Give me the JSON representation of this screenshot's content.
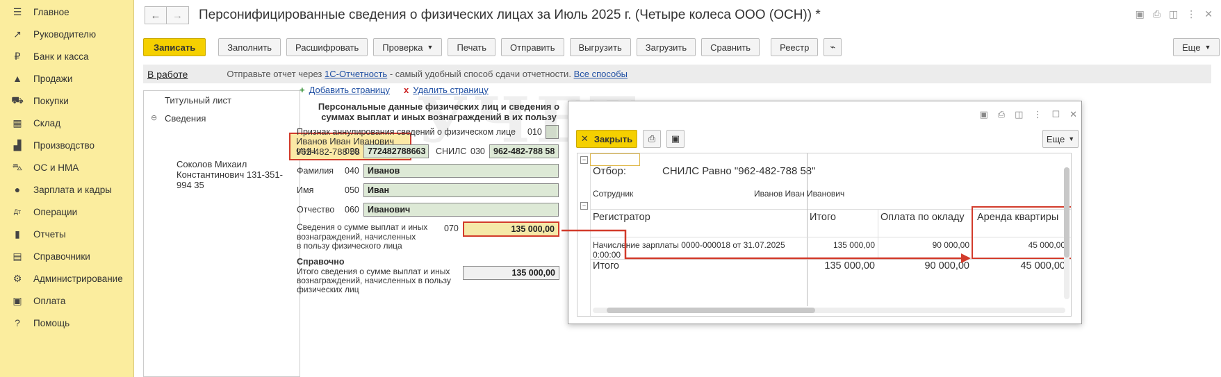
{
  "sidebar": {
    "items": [
      {
        "label": "Главное",
        "icon": "menu-icon"
      },
      {
        "label": "Руководителю",
        "icon": "trend-icon"
      },
      {
        "label": "Банк и касса",
        "icon": "ruble-icon"
      },
      {
        "label": "Продажи",
        "icon": "bag-icon"
      },
      {
        "label": "Покупки",
        "icon": "cart-icon"
      },
      {
        "label": "Склад",
        "icon": "grid-icon"
      },
      {
        "label": "Производство",
        "icon": "factory-icon"
      },
      {
        "label": "ОС и НМА",
        "icon": "truck-icon"
      },
      {
        "label": "Зарплата и кадры",
        "icon": "person-icon"
      },
      {
        "label": "Операции",
        "icon": "dt-kt-icon"
      },
      {
        "label": "Отчеты",
        "icon": "bar-chart-icon"
      },
      {
        "label": "Справочники",
        "icon": "book-icon"
      },
      {
        "label": "Администрирование",
        "icon": "gear-icon"
      },
      {
        "label": "Оплата",
        "icon": "wallet-icon"
      },
      {
        "label": "Помощь",
        "icon": "question-icon"
      }
    ]
  },
  "header": {
    "title": "Персонифицированные сведения о физических лицах за Июль 2025 г. (Четыре колеса ООО (ОСН)) *"
  },
  "toolbar": {
    "save": "Записать",
    "fill": "Заполнить",
    "decode": "Расшифровать",
    "check": "Проверка",
    "print": "Печать",
    "send": "Отправить",
    "export": "Выгрузить",
    "import": "Загрузить",
    "compare": "Сравнить",
    "registry": "Реестр",
    "more": "Еще"
  },
  "status": {
    "state": "В работе",
    "hint_before": "Отправьте отчет через",
    "link1": "1С-Отчетность",
    "hint_after": "- самый удобный способ сдачи отчетности.",
    "link2": "Все способы"
  },
  "tree": {
    "title_page": "Титульный лист",
    "section": "Сведения",
    "persons": [
      "Иванов Иван Иванович 962-482-788 58",
      "Соколов Михаил Константинович 131-351-994 35"
    ]
  },
  "form": {
    "add_page": "Добавить страницу",
    "del_page": "Удалить страницу",
    "heading": "Персональные данные физических лиц и сведения о суммах выплат и иных вознаграждений в их пользу",
    "cancel_label": "Признак аннулирования сведений о физическом лице",
    "cancel_code": "010",
    "inn_label": "ИНН",
    "inn_code": "020",
    "inn_value": "772482788663",
    "snils_label": "СНИЛС",
    "snils_code": "030",
    "snils_value": "962-482-788 58",
    "surname_label": "Фамилия",
    "surname_code": "040",
    "surname_value": "Иванов",
    "name_label": "Имя",
    "name_code": "050",
    "name_value": "Иван",
    "patronymic_label": "Отчество",
    "patronymic_code": "060",
    "patronymic_value": "Иванович",
    "sum_label_1": "Сведения о сумме выплат и иных",
    "sum_label_2": "вознаграждений, начисленных",
    "sum_label_3": "в пользу физического лица",
    "sum_code": "070",
    "sum_value": "135 000,00",
    "ref_heading": "Справочно",
    "total_label_1": "Итого сведения о сумме выплат и иных",
    "total_label_2": "вознаграждений, начисленных в пользу",
    "total_label_3": "физических лиц",
    "total_value": "135 000,00"
  },
  "popup": {
    "close": "Закрыть",
    "more": "Еще",
    "filter_label": "Отбор:",
    "filter_value": "СНИЛС Равно \"962-482-788 58\"",
    "employee_label": "Сотрудник",
    "employee_value": "Иванов Иван Иванович",
    "col_registrar": "Регистратор",
    "col_total": "Итого",
    "col_salary": "Оплата по окладу",
    "col_rent": "Аренда квартиры",
    "row_doc_1": "Начисление зарплаты 0000-000018 от 31.07.2025",
    "row_doc_2": "0:00:00",
    "row_total": "135 000,00",
    "row_salary": "90 000,00",
    "row_rent": "45 000,00",
    "sum_label": "Итого",
    "sum_total": "135 000,00",
    "sum_salary": "90 000,00",
    "sum_rent": "45 000,00"
  },
  "colors": {
    "accent_yellow": "#f5d000",
    "sidebar_bg": "#fbed9e",
    "highlight_red": "#d23b2b",
    "link_blue": "#1f4fa3",
    "field_green": "#dde9d6"
  }
}
